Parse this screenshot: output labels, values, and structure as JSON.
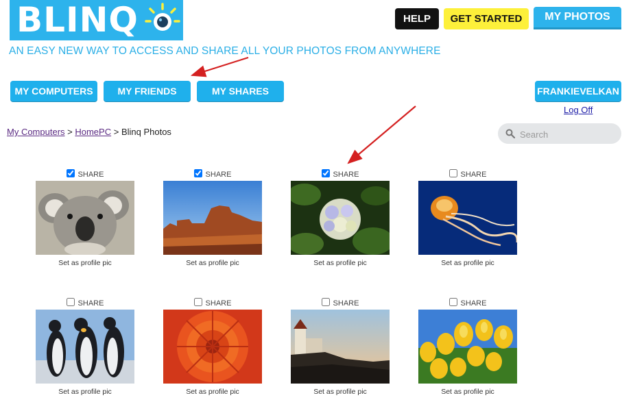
{
  "brand": {
    "logo_text": "BLINQ",
    "tagline": "AN EASY NEW WAY TO ACCESS AND SHARE ALL YOUR PHOTOS FROM ANYWHERE"
  },
  "header": {
    "help_label": "HELP",
    "get_started_label": "GET STARTED",
    "my_photos_label": "MY PHOTOS"
  },
  "nav": {
    "computers_label": "MY COMPUTERS",
    "friends_label": "MY FRIENDS",
    "shares_label": "MY SHARES",
    "user_label": "FRANKIEVELKAN",
    "logoff_label": "Log Off"
  },
  "breadcrumb": {
    "root": "My Computers",
    "sep1": " > ",
    "computer": "HomePC",
    "sep2": " > ",
    "current": "Blinq Photos"
  },
  "search": {
    "placeholder": "Search"
  },
  "colors": {
    "brand_blue": "#2db3ec",
    "help_black": "#111111",
    "get_started_yellow": "#fdf03a",
    "annotation_red": "#d42020"
  },
  "photos": [
    {
      "subject": "koala",
      "share_label": "SHARE",
      "shared": true,
      "profile_label": "Set as profile pic"
    },
    {
      "subject": "desert",
      "share_label": "SHARE",
      "shared": true,
      "profile_label": "Set as profile pic"
    },
    {
      "subject": "hydrangeas",
      "share_label": "SHARE",
      "shared": true,
      "profile_label": "Set as profile pic"
    },
    {
      "subject": "jellyfish",
      "share_label": "SHARE",
      "shared": false,
      "profile_label": "Set as profile pic"
    },
    {
      "subject": "penguins",
      "share_label": "SHARE",
      "shared": false,
      "profile_label": "Set as profile pic"
    },
    {
      "subject": "chrysanthemum",
      "share_label": "SHARE",
      "shared": false,
      "profile_label": "Set as profile pic"
    },
    {
      "subject": "lighthouse",
      "share_label": "SHARE",
      "shared": false,
      "profile_label": "Set as profile pic"
    },
    {
      "subject": "tulips",
      "share_label": "SHARE",
      "shared": false,
      "profile_label": "Set as profile pic"
    }
  ]
}
